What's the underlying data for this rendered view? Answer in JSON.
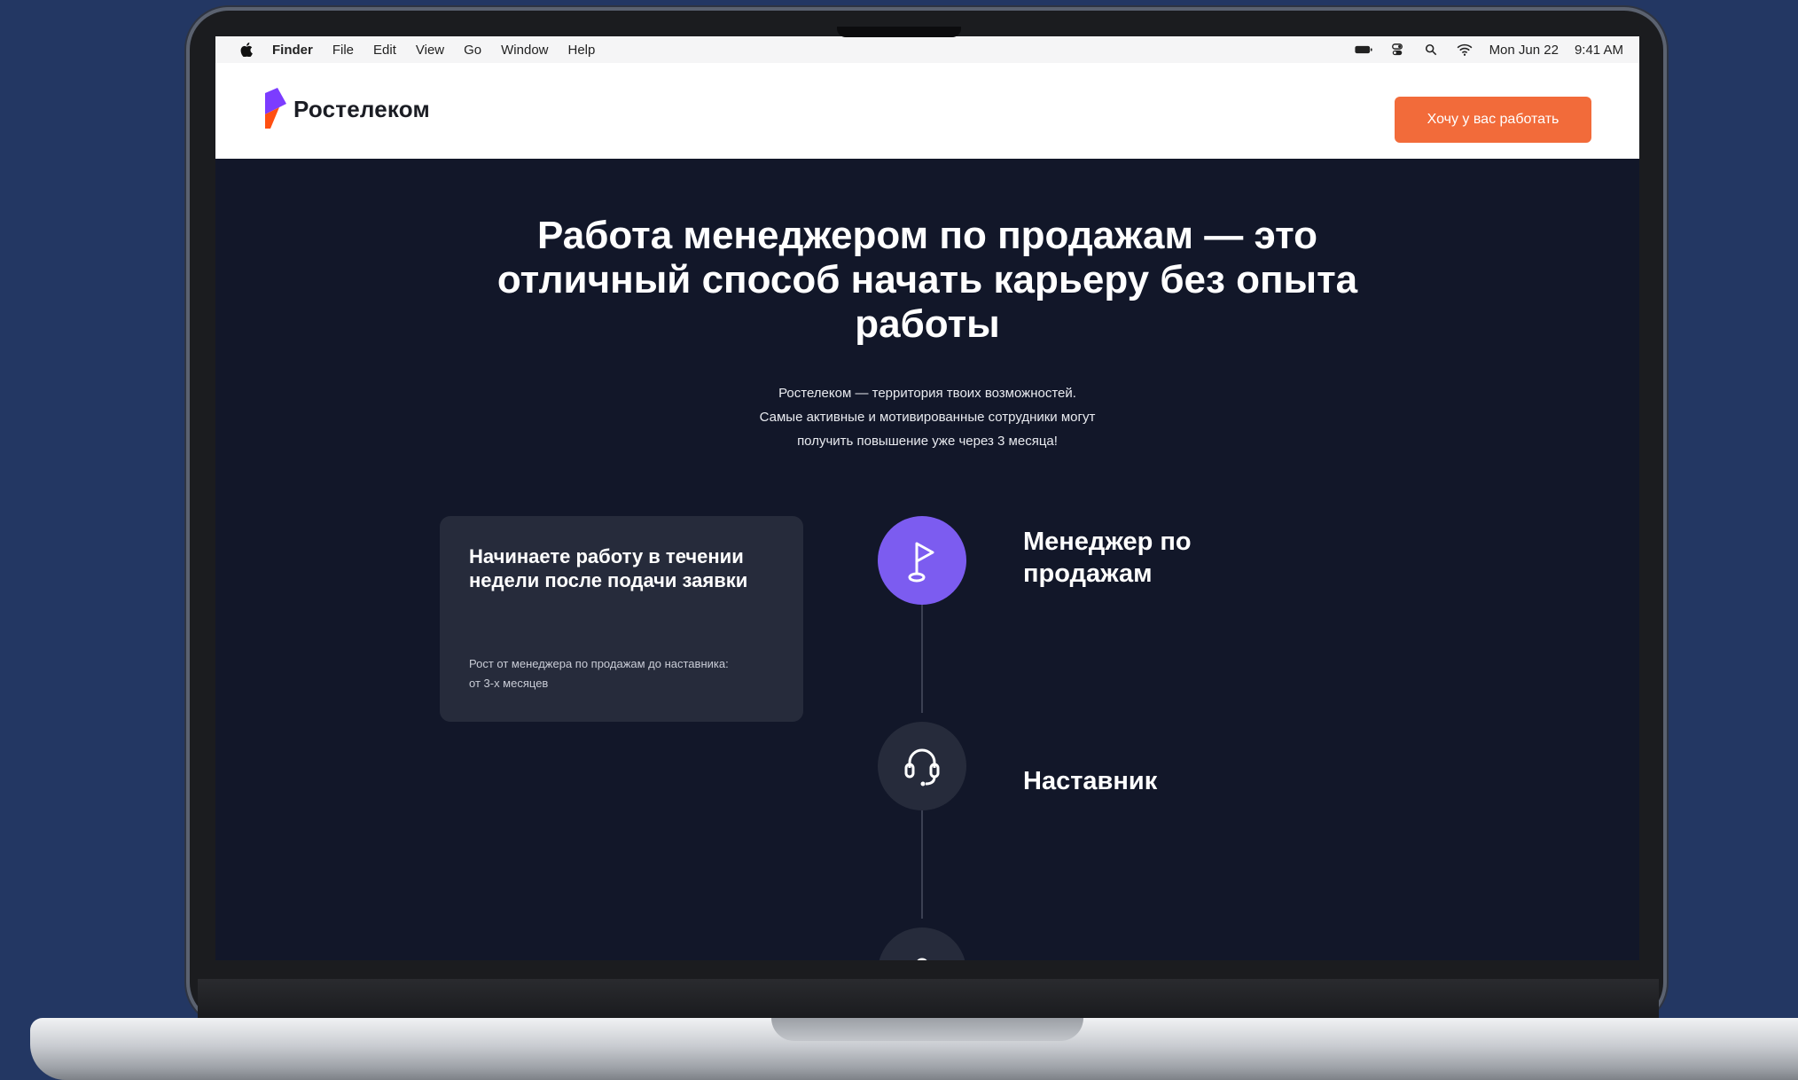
{
  "menubar": {
    "items": [
      "Finder",
      "File",
      "Edit",
      "View",
      "Go",
      "Window",
      "Help"
    ],
    "date": "Mon Jun 22",
    "time": "9:41 AM"
  },
  "header": {
    "logo_text": "Ростелеком",
    "cta_label": "Хочу у вас работать",
    "accent_color": "#f26b3a",
    "logo_color": "#7c3cff"
  },
  "hero": {
    "title": "Работа менеджером по продажам — это отличный способ начать карьеру без опыта работы",
    "subtitle_lines": [
      "Ростелеком — территория твоих возможностей.",
      "Самые активные и мотивированные сотрудники могут",
      "получить повышение уже через 3 месяца!"
    ]
  },
  "card": {
    "title": "Начинаете работу в течении недели после подачи заявки",
    "text": "Рост от менеджера по продажам до наставника: от 3-х месяцев"
  },
  "timeline": {
    "steps": [
      {
        "label": "Менеджер по продажам",
        "icon": "flag-icon",
        "active": true
      },
      {
        "label": "Наставник",
        "icon": "headset-icon",
        "active": false
      }
    ],
    "active_color": "#7c5cf0"
  }
}
